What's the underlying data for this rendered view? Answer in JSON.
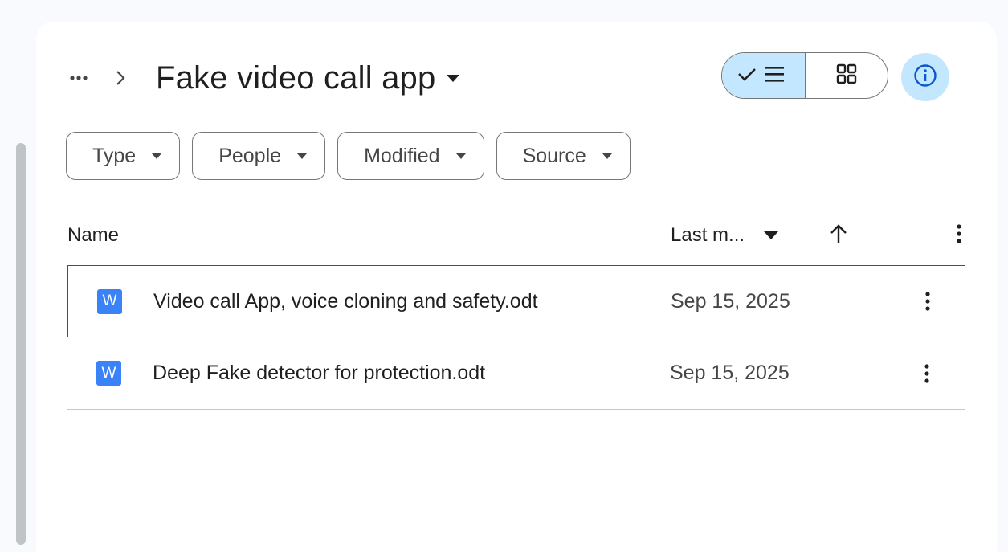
{
  "breadcrumb": {
    "more_icon": "more-horiz-icon",
    "separator_icon": "chevron-right-icon",
    "title": "Fake video call app",
    "title_caret_icon": "arrow-drop-down-icon"
  },
  "view_toggle": {
    "list_icon": "check-list-icon",
    "grid_icon": "grid-view-icon",
    "active": "list",
    "active_color": "#c2e7ff"
  },
  "info_button": {
    "icon": "info-icon"
  },
  "filters": [
    {
      "label": "Type"
    },
    {
      "label": "People"
    },
    {
      "label": "Modified"
    },
    {
      "label": "Source"
    }
  ],
  "columns": {
    "name": "Name",
    "sort_label": "Last m...",
    "sort_direction_icon": "arrow-up-icon",
    "more_icon": "more-vert-icon"
  },
  "files": [
    {
      "icon": "word-doc-icon",
      "icon_letter": "W",
      "name": "Video call App, voice cloning and safety.odt",
      "date": "Sep 15, 2025",
      "selected": true
    },
    {
      "icon": "word-doc-icon",
      "icon_letter": "W",
      "name": "Deep Fake detector for protection.odt",
      "date": "Sep 15, 2025",
      "selected": false
    }
  ],
  "colors": {
    "accent": "#0b57d0",
    "doc_icon": "#3a82f7"
  }
}
